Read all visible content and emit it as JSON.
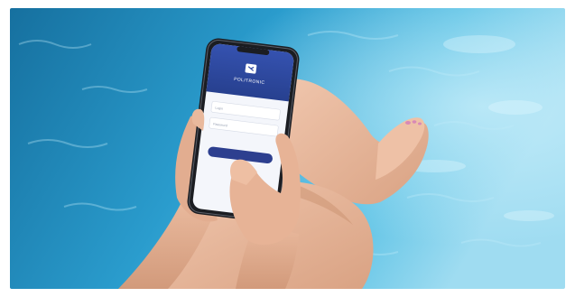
{
  "photo": {
    "subject": "hands-holding-smartphone-by-pool",
    "colors": {
      "water_deep": "#1f7fb0",
      "water_mid": "#2fa7d6",
      "water_light": "#7ed2ee",
      "skin": "#e6b79c",
      "skin_shadow": "#c98f72",
      "phone_body": "#1b1d22",
      "screen_header": "#2f4aa3",
      "screen_bg": "#f4f6fb",
      "button": "#2d3f8f",
      "nail_polish": "#d889b6"
    }
  },
  "phone": {
    "app_name": "POLITRONIC",
    "fields": [
      {
        "label": "Login"
      },
      {
        "label": "Password"
      }
    ]
  }
}
